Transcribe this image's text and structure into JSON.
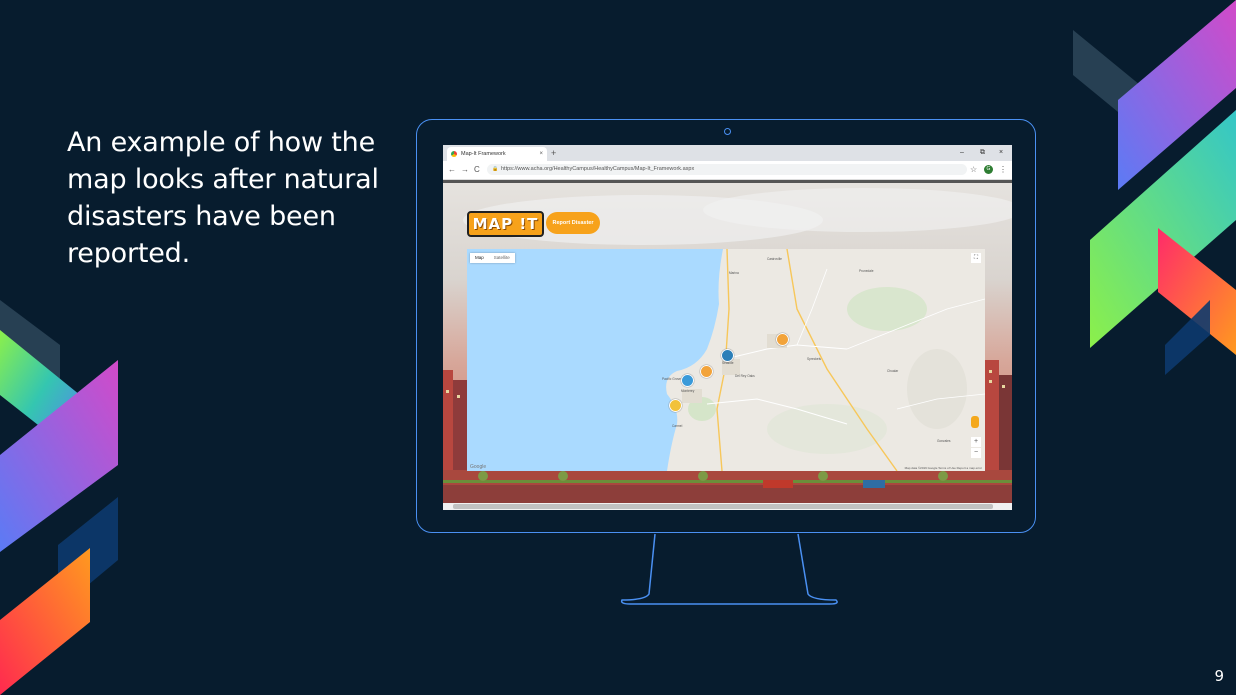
{
  "slide": {
    "caption": "An example of how the map looks after natural disasters have been reported.",
    "page_number": "9",
    "colors": {
      "background": "#071c2e",
      "monitor_outline": "#4a90f2",
      "accent_orange": "#f7a21b"
    }
  },
  "browser": {
    "tab_title": "Map-It Framework",
    "tab_close": "×",
    "new_tab": "+",
    "window_controls": [
      "–",
      "⧉",
      "×"
    ],
    "back": "←",
    "forward": "→",
    "reload": "C",
    "url": "https://www.acha.org/HealthyCampus/HealthyCampus/Map-It_Framework.aspx",
    "bookmark": "☆",
    "profile_initial": "G",
    "menu": "⋮"
  },
  "page": {
    "logo_text": "MAP !T",
    "report_button": "Report Disaster",
    "map": {
      "map_type_options": [
        "Map",
        "Satellite"
      ],
      "selected_map_type": "Map",
      "fullscreen_icon": "⛶",
      "zoom_in": "+",
      "zoom_out": "−",
      "google_label": "Google",
      "terms": "Map data ©2019 Google  Terms of Use  Report a map error",
      "places": [
        {
          "name": "Marina"
        },
        {
          "name": "Castroville"
        },
        {
          "name": "Prunedale"
        },
        {
          "name": "Salinas"
        },
        {
          "name": "Seaside"
        },
        {
          "name": "Monterey"
        },
        {
          "name": "Pacific Grove"
        },
        {
          "name": "Carmel"
        },
        {
          "name": "Del Rey Oaks"
        },
        {
          "name": "Spreckels"
        },
        {
          "name": "Chualar"
        },
        {
          "name": "Gonzales"
        }
      ],
      "markers": [
        {
          "type": "storm",
          "color": "#f2a33a"
        },
        {
          "type": "flood",
          "color": "#2c7fb8"
        },
        {
          "type": "fire",
          "color": "#f2a33a"
        },
        {
          "type": "earthquake",
          "color": "#f2c23a"
        },
        {
          "type": "landslide",
          "color": "#3a9ad9"
        }
      ]
    }
  }
}
